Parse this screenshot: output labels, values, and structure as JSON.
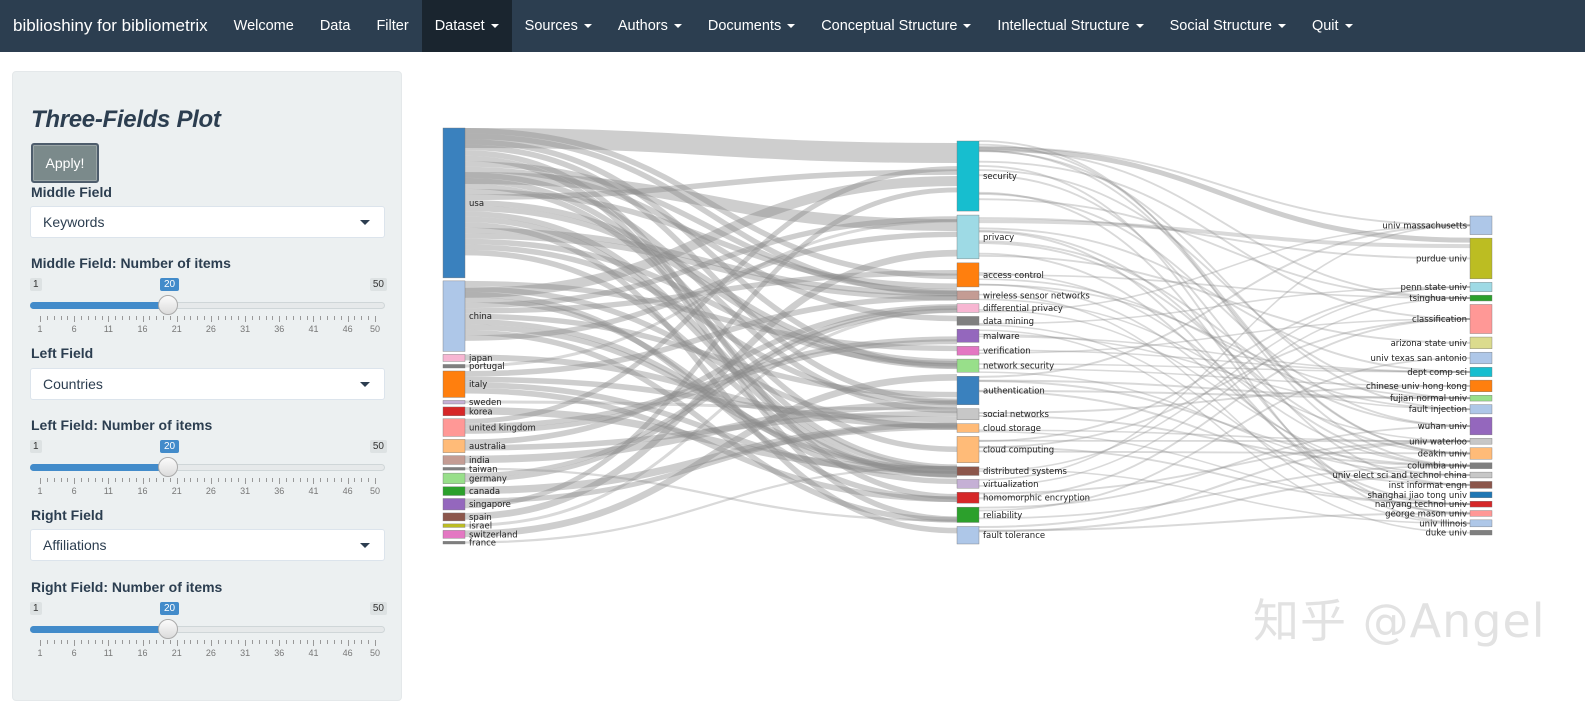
{
  "navbar": {
    "brand": "biblioshiny for bibliometrix",
    "items": [
      {
        "label": "Welcome",
        "dropdown": false,
        "active": false
      },
      {
        "label": "Data",
        "dropdown": false,
        "active": false
      },
      {
        "label": "Filter",
        "dropdown": false,
        "active": false
      },
      {
        "label": "Dataset",
        "dropdown": true,
        "active": true
      },
      {
        "label": "Sources",
        "dropdown": true,
        "active": false
      },
      {
        "label": "Authors",
        "dropdown": true,
        "active": false
      },
      {
        "label": "Documents",
        "dropdown": true,
        "active": false
      },
      {
        "label": "Conceptual Structure",
        "dropdown": true,
        "active": false
      },
      {
        "label": "Intellectual Structure",
        "dropdown": true,
        "active": false
      },
      {
        "label": "Social Structure",
        "dropdown": true,
        "active": false
      },
      {
        "label": "Quit",
        "dropdown": true,
        "active": false
      }
    ]
  },
  "sidebar": {
    "title": "Three-Fields Plot",
    "apply_label": "Apply!",
    "middle_field": {
      "label": "Middle Field",
      "value": "Keywords"
    },
    "middle_items": {
      "label": "Middle Field: Number of items",
      "min": "1",
      "max": "50",
      "value": "20",
      "fraction": 0.388
    },
    "left_field": {
      "label": "Left Field",
      "value": "Countries"
    },
    "left_items": {
      "label": "Left Field: Number of items",
      "min": "1",
      "max": "50",
      "value": "20",
      "fraction": 0.388
    },
    "right_field": {
      "label": "Right Field",
      "value": "Affiliations"
    },
    "right_items": {
      "label": "Right Field: Number of items",
      "min": "1",
      "max": "50",
      "value": "20",
      "fraction": 0.388
    },
    "tick_labels": [
      "1",
      "6",
      "11",
      "16",
      "21",
      "26",
      "31",
      "36",
      "41",
      "46",
      "50"
    ]
  },
  "sankey": {
    "left": [
      {
        "label": "usa",
        "color": "#3a81be",
        "weight": 34
      },
      {
        "label": "china",
        "color": "#aec7e8",
        "weight": 16
      },
      {
        "label": "japan",
        "color": "#f7b6d2",
        "weight": 1.6
      },
      {
        "label": "portugal",
        "color": "#7f7f7f",
        "weight": 0.8
      },
      {
        "label": "italy",
        "color": "#ff7f0e",
        "weight": 6
      },
      {
        "label": "sweden",
        "color": "#c5b0d5",
        "weight": 0.8
      },
      {
        "label": "korea",
        "color": "#d62728",
        "weight": 2
      },
      {
        "label": "united kingdom",
        "color": "#ff9896",
        "weight": 4
      },
      {
        "label": "australia",
        "color": "#ffbb78",
        "weight": 3
      },
      {
        "label": "india",
        "color": "#c49c94",
        "weight": 2
      },
      {
        "label": "taiwan",
        "color": "#7f7f7f",
        "weight": 0.6
      },
      {
        "label": "germany",
        "color": "#98df8a",
        "weight": 2.4
      },
      {
        "label": "canada",
        "color": "#2ca02c",
        "weight": 2
      },
      {
        "label": "singapore",
        "color": "#9467bd",
        "weight": 2.6
      },
      {
        "label": "spain",
        "color": "#8c564b",
        "weight": 1.8
      },
      {
        "label": "israel",
        "color": "#bcbd22",
        "weight": 0.8
      },
      {
        "label": "switzerland",
        "color": "#e377c2",
        "weight": 1.8
      },
      {
        "label": "france",
        "color": "#7f7f7f",
        "weight": 0.6
      }
    ],
    "middle": [
      {
        "label": "security",
        "color": "#17becf",
        "weight": 16
      },
      {
        "label": "privacy",
        "color": "#9edae5",
        "weight": 10
      },
      {
        "label": "access control",
        "color": "#ff7f0e",
        "weight": 5.5
      },
      {
        "label": "wireless sensor networks",
        "color": "#c49c94",
        "weight": 2
      },
      {
        "label": "differential privacy",
        "color": "#f7b6d2",
        "weight": 2
      },
      {
        "label": "data mining",
        "color": "#7f7f7f",
        "weight": 2
      },
      {
        "label": "malware",
        "color": "#9467bd",
        "weight": 3
      },
      {
        "label": "verification",
        "color": "#e377c2",
        "weight": 2
      },
      {
        "label": "network security",
        "color": "#98df8a",
        "weight": 3
      },
      {
        "label": "authentication",
        "color": "#3a81be",
        "weight": 6.5
      },
      {
        "label": "social networks",
        "color": "#c7c7c7",
        "weight": 2.5
      },
      {
        "label": "cloud storage",
        "color": "#ffbb78",
        "weight": 2
      },
      {
        "label": "cloud computing",
        "color": "#ffbb78",
        "weight": 6
      },
      {
        "label": "distributed systems",
        "color": "#8c564b",
        "weight": 2
      },
      {
        "label": "virtualization",
        "color": "#c5b0d5",
        "weight": 2
      },
      {
        "label": "homomorphic encryption",
        "color": "#d62728",
        "weight": 2.5
      },
      {
        "label": "reliability",
        "color": "#2ca02c",
        "weight": 3.5
      },
      {
        "label": "fault tolerance",
        "color": "#aec7e8",
        "weight": 4
      }
    ],
    "right": [
      {
        "label": "univ massachusetts",
        "color": "#aec7e8",
        "weight": 1.6
      },
      {
        "label": "purdue univ",
        "color": "#bcbd22",
        "weight": 3.5
      },
      {
        "label": "penn state univ",
        "color": "#9edae5",
        "weight": 0.8
      },
      {
        "label": "tsinghua univ",
        "color": "#2ca02c",
        "weight": 0.5
      },
      {
        "label": "classification",
        "color": "#ff9896",
        "weight": 2.5
      },
      {
        "label": "arizona state univ",
        "color": "#dbdb8d",
        "weight": 1
      },
      {
        "label": "univ texas san antonio",
        "color": "#aec7e8",
        "weight": 1
      },
      {
        "label": "dept comp sci",
        "color": "#17becf",
        "weight": 0.8
      },
      {
        "label": "chinese univ hong kong",
        "color": "#ff7f0e",
        "weight": 1
      },
      {
        "label": "fujian normal univ",
        "color": "#98df8a",
        "weight": 0.5
      },
      {
        "label": "fault injection",
        "color": "#aec7e8",
        "weight": 0.8
      },
      {
        "label": "wuhan univ",
        "color": "#9467bd",
        "weight": 1.5
      },
      {
        "label": "univ waterloo",
        "color": "#c7c7c7",
        "weight": 0.5
      },
      {
        "label": "deakin univ",
        "color": "#ffbb78",
        "weight": 1
      },
      {
        "label": "columbia univ",
        "color": "#7f7f7f",
        "weight": 0.5
      },
      {
        "label": "univ elect sci and technol china",
        "color": "#c7c7c7",
        "weight": 0.5
      },
      {
        "label": "inst informat engn",
        "color": "#8c564b",
        "weight": 0.6
      },
      {
        "label": "shanghai jiao tong univ",
        "color": "#1f77b4",
        "weight": 0.5
      },
      {
        "label": "nanyang technol univ",
        "color": "#d62728",
        "weight": 0.5
      },
      {
        "label": "george mason univ",
        "color": "#ff9896",
        "weight": 0.5
      },
      {
        "label": "univ illinois",
        "color": "#aec7e8",
        "weight": 0.6
      },
      {
        "label": "duke univ",
        "color": "#7f7f7f",
        "weight": 0.4
      }
    ]
  },
  "watermark": "知乎 @Angel"
}
